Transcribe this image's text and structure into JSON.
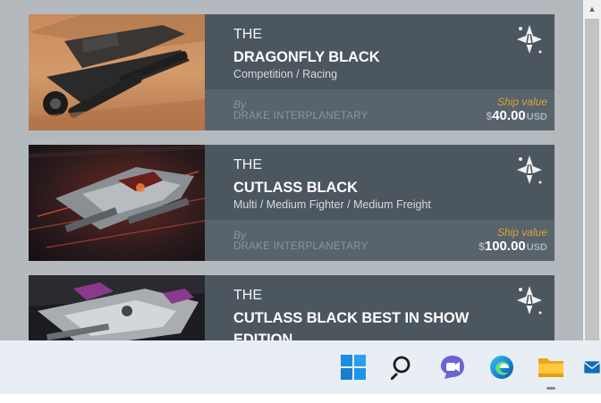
{
  "ships": [
    {
      "the": "THE",
      "name": "DRAGONFLY BLACK",
      "type": "Competition / Racing",
      "by": "By",
      "manufacturer": "DRAKE INTERPLANETARY",
      "value_label": "Ship value",
      "currency_symbol": "$",
      "price": "40.00",
      "currency": "USD",
      "image": "dragonfly-desert"
    },
    {
      "the": "THE",
      "name": "CUTLASS BLACK",
      "type": "Multi / Medium Fighter / Medium Freight",
      "by": "By",
      "manufacturer": "DRAKE INTERPLANETARY",
      "value_label": "Ship value",
      "currency_symbol": "$",
      "price": "100.00",
      "currency": "USD",
      "image": "cutlass-red"
    },
    {
      "the": "THE",
      "name": "CUTLASS BLACK BEST IN SHOW EDITION",
      "image": "cutlass-purple"
    }
  ],
  "badge_icon": "ship-badge-icon",
  "taskbar": {
    "icons": [
      "windows-start-icon",
      "search-icon",
      "teams-chat-icon",
      "edge-browser-icon",
      "file-explorer-icon",
      "mail-icon"
    ]
  },
  "colors": {
    "card_body": "#4c565f",
    "card_footer": "#59636c",
    "value_accent": "#d7a23c",
    "page_background": "#b4b9bd"
  }
}
